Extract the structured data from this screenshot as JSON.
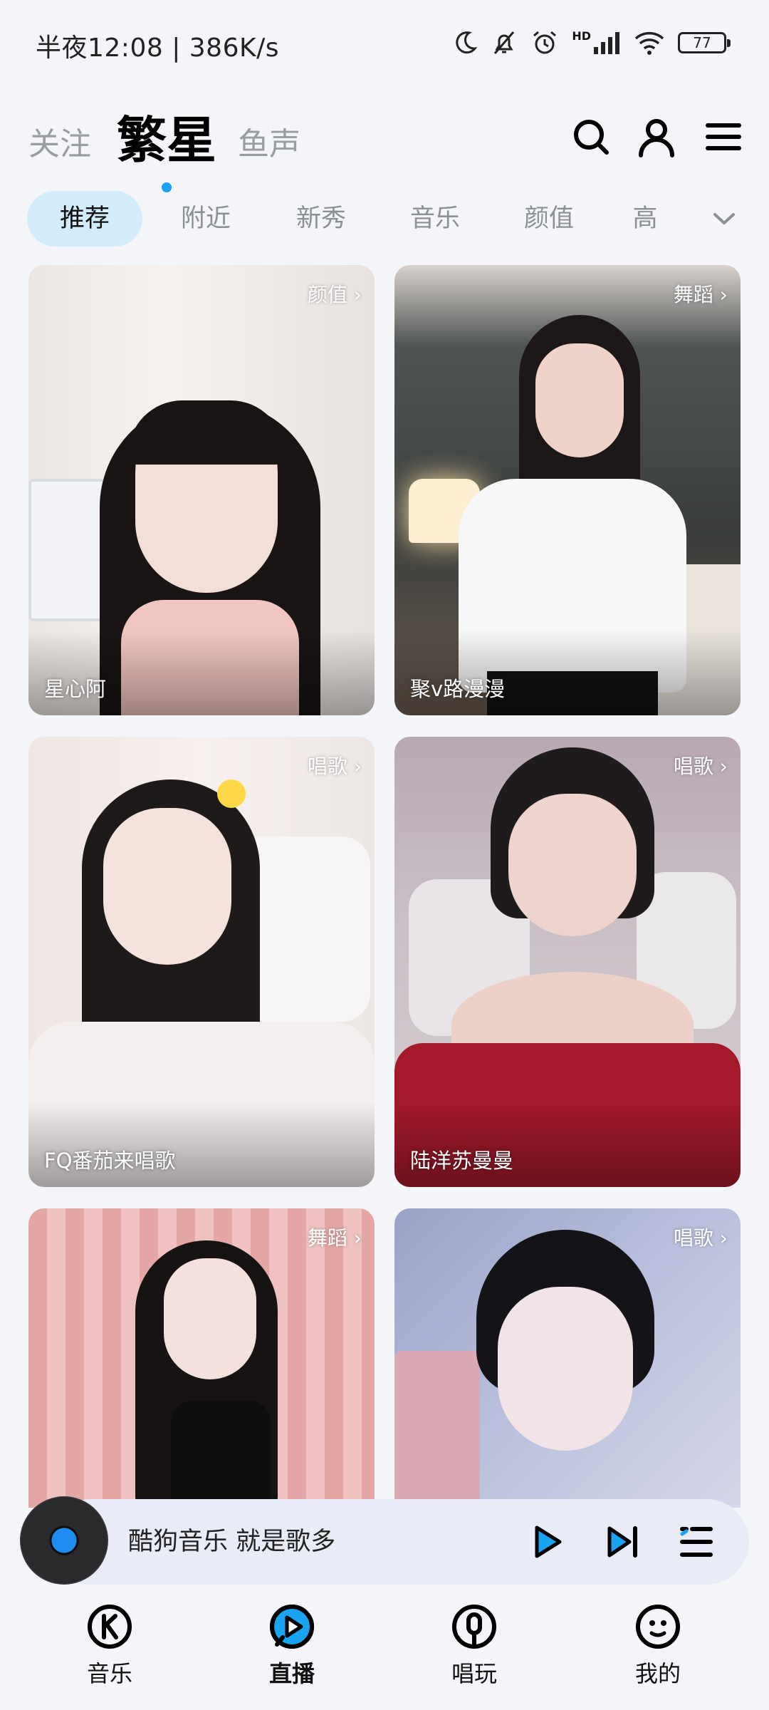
{
  "status_bar": {
    "time_speed": "半夜12:08 | 386K/s",
    "battery": "77",
    "network_badge": "HD",
    "icons": [
      "moon-icon",
      "mute-bell-icon",
      "alarm-icon",
      "signal-icon",
      "wifi-icon",
      "battery-icon"
    ]
  },
  "top_tabs": [
    "关注",
    "繁星",
    "鱼声"
  ],
  "active_top_tab": "繁星",
  "header_icons": [
    "search-icon",
    "user-icon",
    "menu-icon"
  ],
  "categories": [
    "推荐",
    "附近",
    "新秀",
    "音乐",
    "颜值",
    "高"
  ],
  "active_category": "推荐",
  "cards": [
    {
      "name": "星心阿",
      "tag": "颜值 ›"
    },
    {
      "name": "聚v路漫漫",
      "tag": "舞蹈 ›"
    },
    {
      "name": "FQ番茄来唱歌",
      "tag": "唱歌 ›"
    },
    {
      "name": "陆洋苏曼曼",
      "tag": "唱歌 ›"
    },
    {
      "name": "",
      "tag": "舞蹈 ›"
    },
    {
      "name": "",
      "tag": "唱歌 ›"
    }
  ],
  "player": {
    "text": "酷狗音乐  就是歌多",
    "icons": [
      "play-icon",
      "next-icon",
      "playlist-icon"
    ]
  },
  "bottom_nav": [
    {
      "label": "音乐",
      "icon": "music-k-icon"
    },
    {
      "label": "直播",
      "icon": "live-icon"
    },
    {
      "label": "唱玩",
      "icon": "mic-icon"
    },
    {
      "label": "我的",
      "icon": "profile-face-icon"
    }
  ],
  "active_bottom_tab": "直播",
  "colors": {
    "accent": "#1aa3f0",
    "chip_active_bg": "#d3ecfb",
    "background": "#f4f5f9",
    "player_bg": "#e9ecf7"
  }
}
